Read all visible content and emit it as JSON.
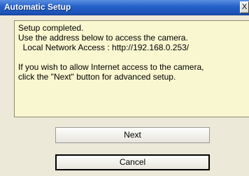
{
  "window": {
    "title": "Automatic Setup",
    "close_label": "X"
  },
  "message": {
    "lines": [
      "Setup completed.",
      "Use the address below to access the camera.",
      "  Local Network Access : http://192.168.0.253/",
      "",
      "If you wish to allow Internet access to the camera,",
      "click the \"Next\" button for advanced setup."
    ]
  },
  "buttons": {
    "next_label": "Next",
    "cancel_label": "Cancel"
  },
  "colors": {
    "titlebar": "#2461c9",
    "panel_background": "#f8f7d0",
    "dialog_background": "#ece9d8"
  }
}
